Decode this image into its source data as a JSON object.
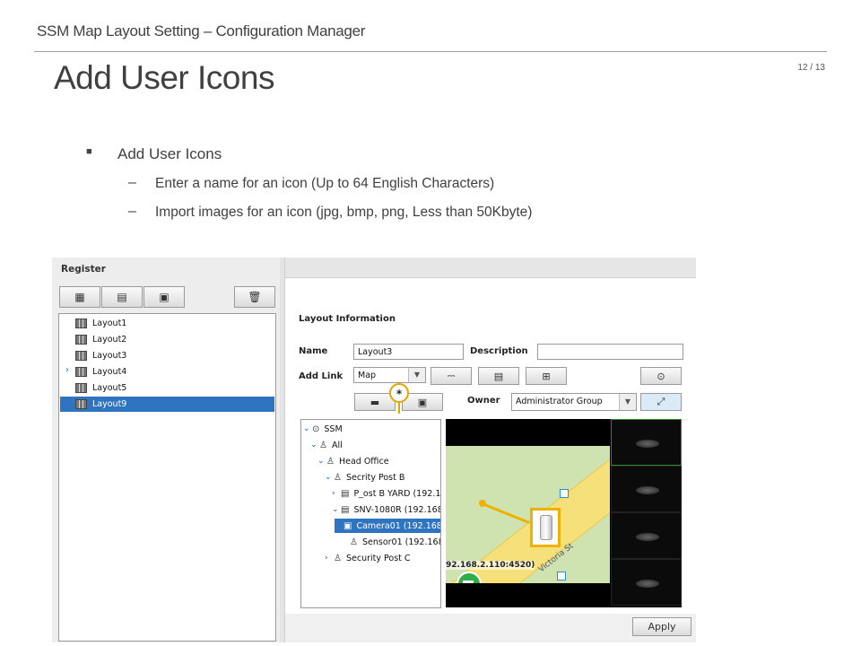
{
  "slide": {
    "header": "SSM Map Layout Setting – Configuration Manager",
    "page_number": "12 / 13",
    "title": "Add User Icons",
    "bullet": "Add User  Icons",
    "dash": "–",
    "sub_items": [
      "Enter a name for an icon (Up to 64 English Characters)",
      "Import images for an icon (jpg, bmp, png, Less than 50Kbyte)"
    ]
  },
  "app": {
    "register_title": "Register",
    "layouts": [
      "Layout1",
      "Layout2",
      "Layout3",
      "Layout4",
      "Layout5",
      "Layout9"
    ],
    "selected_layout": "Layout9",
    "layout_info_title": "Layout Information",
    "name_label": "Name",
    "name_value": "Layout3",
    "description_label": "Description",
    "description_value": "",
    "add_link_label": "Add Link",
    "add_link_value": "Map",
    "owner_label": "Owner",
    "owner_value": "Administrator Group",
    "callout_mark": "*",
    "apply_label": "Apply",
    "tree": {
      "root": "SSM",
      "all": "All",
      "head_office": "Head Office",
      "post_b": "Secrity Post B",
      "yard": "P_ost B YARD (192.1",
      "nvr": "SNV-1080R (192.168",
      "camera": "Camera01 (192.168",
      "sensor": "Sensor01 (192.168",
      "post_c": "Security Post C"
    },
    "map": {
      "street": "Victoria St",
      "device_label": "92.168.2.110:4520)"
    }
  }
}
